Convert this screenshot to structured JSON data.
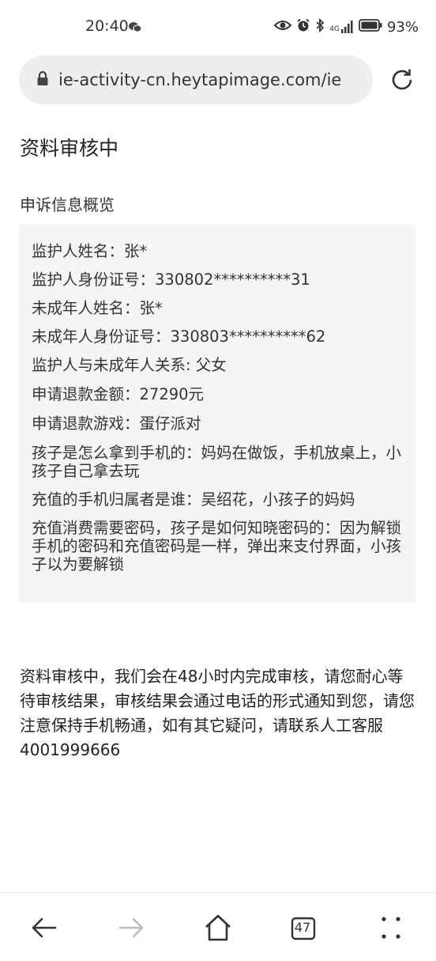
{
  "status_bar": {
    "time": "20:40",
    "network_label": "4G",
    "battery": "93%"
  },
  "browser": {
    "url": "ie-activity-cn.heytapimage.com/ie",
    "tab_count": "47"
  },
  "page": {
    "title": "资料审核中",
    "section_title": "申诉信息概览",
    "info_rows": [
      "监护人姓名：张*",
      "监护人身份证号：330802**********31",
      "未成年人姓名：张*",
      "未成年人身份证号：330803**********62",
      "监护人与未成年人关系: 父女",
      "申请退款金额：27290元",
      "申请退款游戏：蛋仔派对",
      "孩子是怎么拿到手机的：妈妈在做饭，手机放桌上，小孩子自己拿去玩",
      "充值的手机归属者是谁：吴绍花，小孩子的妈妈",
      "充值消费需要密码，孩子是如何知晓密码的：因为解锁手机的密码和充值密码是一样，弹出来支付界面，小孩子以为要解锁"
    ],
    "notice": "资料审核中，我们会在48小时内完成审核，请您耐心等待审核结果，审核结果会通过电话的形式通知到您，请您注意保持手机畅通，如有其它疑问，请联系人工客服4001999666"
  },
  "icons": {
    "status": [
      "wechat-icon",
      "eye-icon",
      "alarm-icon",
      "bluetooth-icon",
      "signal-icon",
      "battery-icon"
    ],
    "browser": [
      "lock-icon",
      "reload-icon",
      "back-icon",
      "forward-icon",
      "home-icon",
      "tabs-icon",
      "menu-icon"
    ]
  },
  "colors": {
    "background": "#ffffff",
    "info_box": "#f5f5f5",
    "text": "#222222",
    "disabled": "#bbbbbb"
  }
}
